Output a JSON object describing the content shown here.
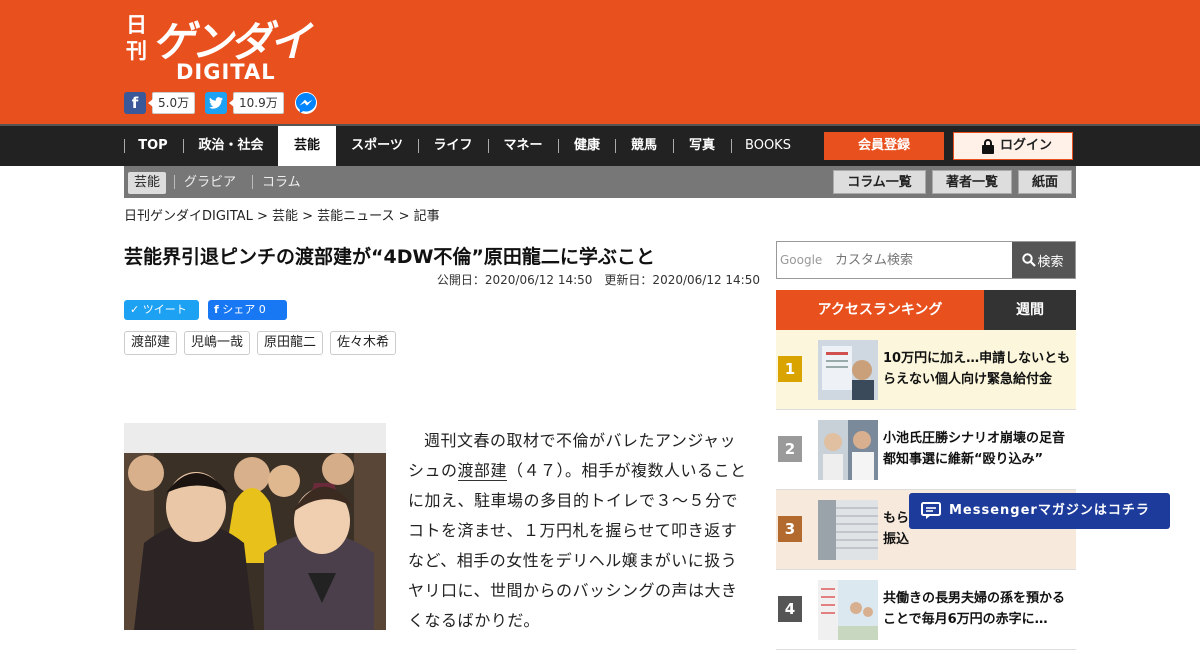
{
  "logo": {
    "kanji": "日刊",
    "kana": "ゲンダイ",
    "digital": "DIGITAL"
  },
  "social": {
    "facebook_count": "5.0万",
    "twitter_count": "10.9万"
  },
  "nav": {
    "items": [
      "TOP",
      "政治・社会",
      "芸能",
      "スポーツ",
      "ライフ",
      "マネー",
      "健康",
      "競馬",
      "写真",
      "BOOKS"
    ],
    "register": "会員登録",
    "login": "ログイン"
  },
  "subnav": {
    "items": [
      "芸能",
      "グラビア",
      "コラム"
    ],
    "buttons": [
      "コラム一覧",
      "著者一覧",
      "紙面"
    ]
  },
  "breadcrumb": "日刊ゲンダイDIGITAL > 芸能 > 芸能ニュース > 記事",
  "article": {
    "title": "芸能界引退ピンチの渡部建が“4DW不倫”原田龍二に学ぶこと",
    "dates": "公開日：2020/06/12 14:50　更新日：2020/06/12 14:50",
    "tweet": "ツイート",
    "share": "シェア 0",
    "tags": [
      "渡部建",
      "児嶋一哉",
      "原田龍二",
      "佐々木希"
    ],
    "body_pre": "週刊文春の取材で不倫がバレたアンジャッシュの",
    "body_link": "渡部建",
    "body_post": "（４７）。相手が複数人いることに加え、駐車場の多目的トイレで３～５分でコトを済ませ、１万円札を握らせて叩き返すなど、相手の女性をデリヘル嬢まがいに扱うヤリ口に、世間からのバッシングの声は大きくなるばかりだ。"
  },
  "search": {
    "google": "Google",
    "placeholder": "カスタム検索",
    "button": "検索"
  },
  "ranking": {
    "tab_access": "アクセスランキング",
    "tab_weekly": "週間",
    "items": [
      {
        "num": "1",
        "title": "10万円に加え…申請しないともらえない個人向け緊急給付金",
        "color": "#d9a400"
      },
      {
        "num": "2",
        "title": "小池氏圧勝シナリオ崩壊の足音 都知事選に維新“殴り込み”",
        "color": "#9a9a9a"
      },
      {
        "num": "3",
        "title": "もら…金」は社員の口座に直接振込",
        "color": "#b26a2e"
      },
      {
        "num": "4",
        "title": "共働きの長男夫婦の孫を預かることで毎月6万円の赤字に…",
        "color": "#555555"
      }
    ]
  },
  "messenger": "Messengerマガジンはコチラ"
}
